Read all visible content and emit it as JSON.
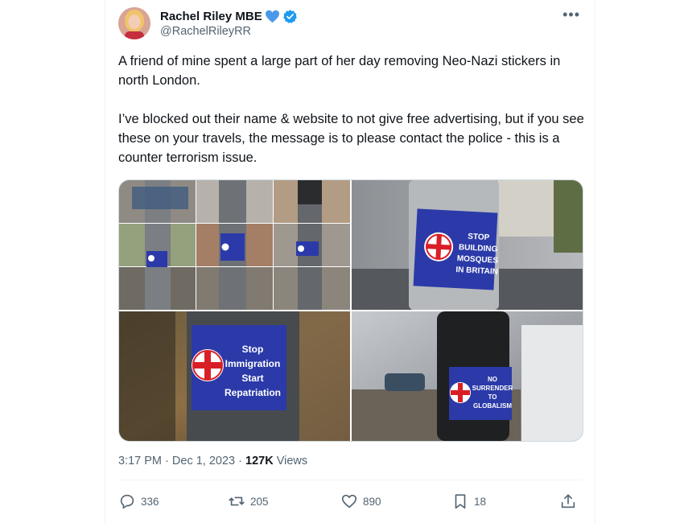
{
  "author": {
    "name": "Rachel Riley MBE",
    "handle": "@RachelRileyRR",
    "heart_color": "#4a99e9",
    "verified_color": "#1d9bf0"
  },
  "tweet": {
    "paragraph1": "A friend of mine spent a large part of her day removing Neo-Nazi stickers in north London.",
    "paragraph2": "I’ve blocked out their name & website to not give free advertising, but if you see these on your travels, the message is to please contact the police - this is a counter terrorism issue."
  },
  "media": {
    "photo_b_lines": [
      "STOP",
      "BUILDING",
      "MOSQUES",
      "IN BRITAIN"
    ],
    "photo_c_lines": [
      "Stop",
      "Immigration",
      "Start",
      "Repatriation"
    ],
    "photo_d_lines": [
      "NO",
      "SURRENDER",
      "TO",
      "GLOBALISM"
    ],
    "sticker_color": "#2b3aa8",
    "cross_color": "#d91f26"
  },
  "meta": {
    "time": "3:17 PM",
    "separator": "·",
    "date": "Dec 1, 2023",
    "views_count": "127K",
    "views_label": "Views"
  },
  "actions": {
    "replies": "336",
    "reposts": "205",
    "likes": "890",
    "bookmarks": "18"
  },
  "icons": [
    "verified-badge-icon",
    "blue-heart-icon",
    "more-icon",
    "reply-icon",
    "repost-icon",
    "like-icon",
    "bookmark-icon",
    "share-icon"
  ]
}
